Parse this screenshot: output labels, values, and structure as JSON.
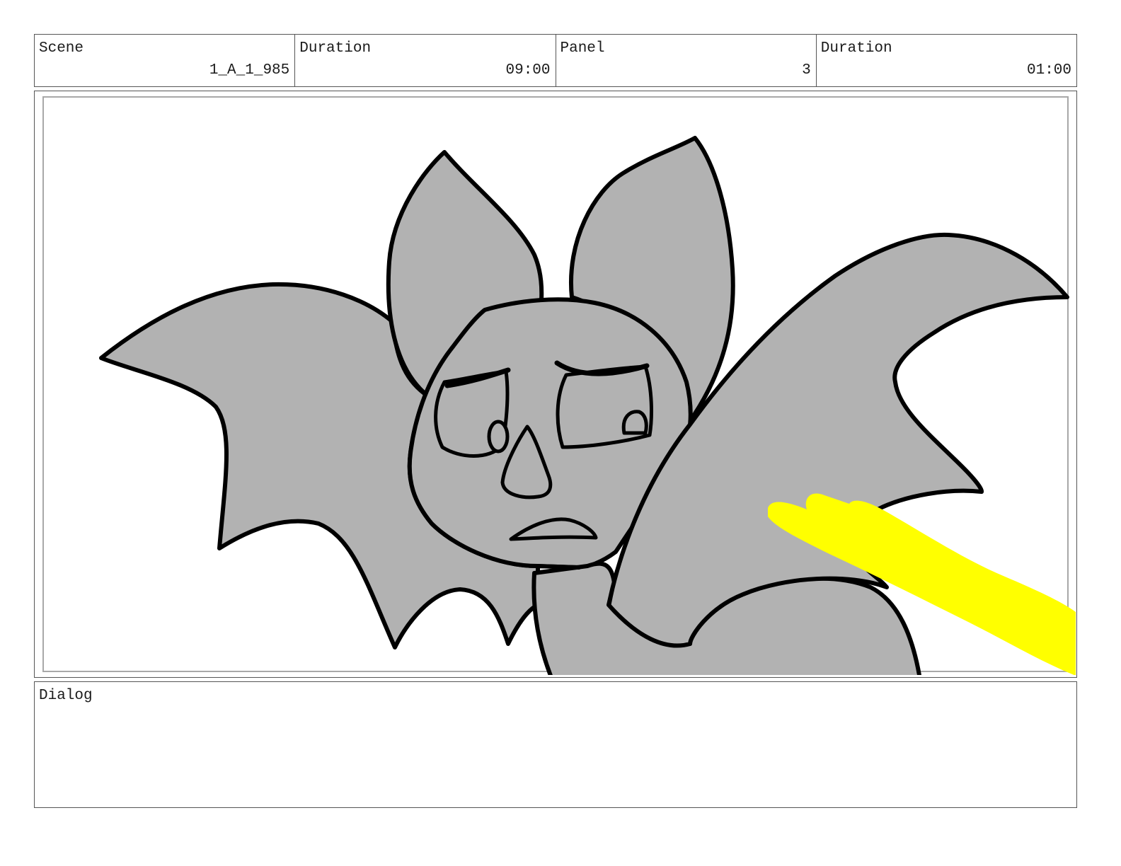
{
  "header": {
    "scene_label": "Scene",
    "scene_value": "1_A_1_985",
    "scene_duration_label": "Duration",
    "scene_duration_value": "09:00",
    "panel_label": "Panel",
    "panel_value": "3",
    "panel_duration_label": "Duration",
    "panel_duration_value": "01:00"
  },
  "dialog": {
    "label": "Dialog",
    "text": ""
  },
  "colors": {
    "body_fill": "#b2b2b2",
    "outline": "#000000",
    "highlight": "#ffff00",
    "frame": "#555555"
  }
}
